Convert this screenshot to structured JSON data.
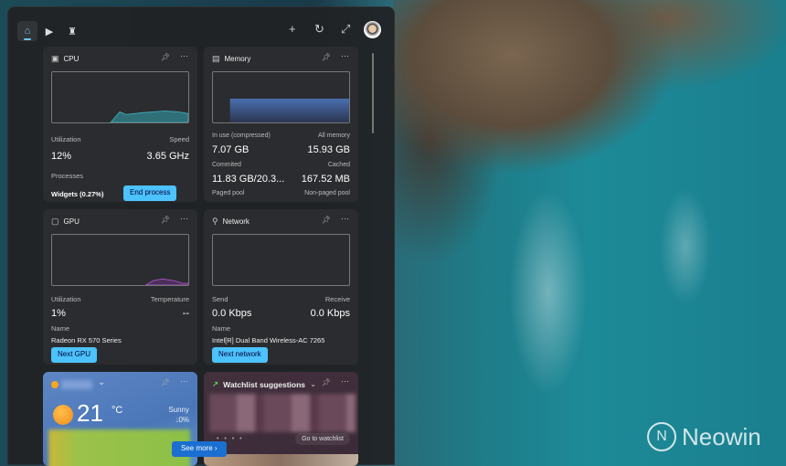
{
  "header": {
    "tabs": [
      {
        "icon": "home-icon",
        "active": true
      },
      {
        "icon": "play-icon"
      },
      {
        "icon": "game-icon"
      }
    ],
    "actions": [
      "add-icon",
      "refresh-icon",
      "expand-icon"
    ]
  },
  "cpu": {
    "title": "CPU",
    "utilization_label": "Utilization",
    "speed_label": "Speed",
    "utilization": "12%",
    "speed": "3.65 GHz",
    "processes_label": "Processes",
    "process": "Widgets (0.27%)",
    "end_button": "End process",
    "graph_color": "#3fa7b3"
  },
  "memory": {
    "title": "Memory",
    "in_use_label": "In use (compressed)",
    "all_label": "All memory",
    "in_use": "7.07 GB",
    "all": "15.93 GB",
    "committed_label": "Commited",
    "cached_label": "Cached",
    "committed": "11.83 GB/20.3...",
    "cached": "167.52 MB",
    "paged_label": "Paged pool",
    "nonpaged_label": "Non-paged pool",
    "graph_color": "#3f5f9a"
  },
  "gpu": {
    "title": "GPU",
    "utilization_label": "Utilization",
    "temperature_label": "Temperature",
    "utilization": "1%",
    "temperature": "--",
    "name_label": "Name",
    "name": "Radeon RX 570 Series",
    "next_button": "Next GPU",
    "graph_color": "#a050c0"
  },
  "network": {
    "title": "Network",
    "send_label": "Send",
    "receive_label": "Receive",
    "send": "0.0 Kbps",
    "receive": "0.0 Kbps",
    "name_label": "Name",
    "name": "Intel[R] Dual Band Wireless-AC 7265",
    "next_button": "Next network"
  },
  "weather": {
    "temperature": "21",
    "unit": "°C",
    "condition": "Sunny",
    "precip": "0%",
    "see_more": "See more"
  },
  "watchlist": {
    "title": "Watchlist suggestions",
    "go_button": "Go to watchlist"
  },
  "watermark": "Neowin"
}
